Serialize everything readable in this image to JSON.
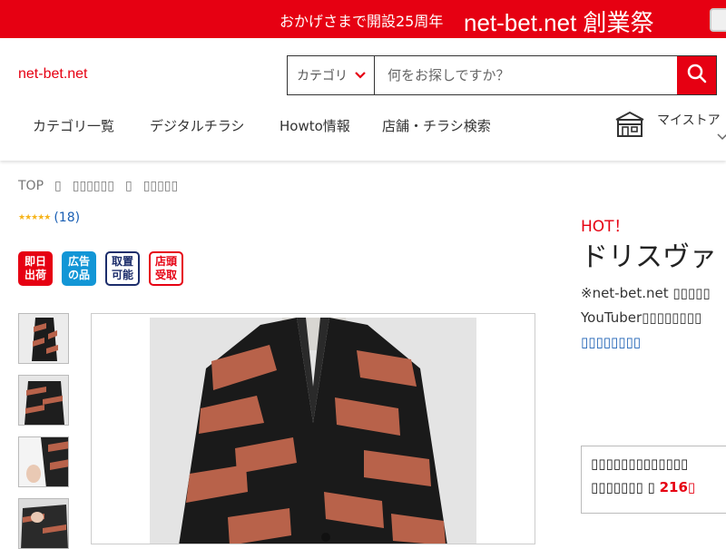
{
  "banner": {
    "subtitle": "おかげさまで開設25周年",
    "title": "net-bet.net 創業祭"
  },
  "header": {
    "logo": "net-bet.net",
    "search": {
      "category_label": "カテゴリ",
      "placeholder": "何をお探しですか？"
    },
    "nav": [
      {
        "label": "カテゴリ一覧"
      },
      {
        "label": "デジタルチラシ"
      },
      {
        "label": "Howto情報"
      },
      {
        "label": "店舗・チラシ検索"
      }
    ],
    "mystore_label": "マイストア"
  },
  "breadcrumb": {
    "top": "TOP",
    "sep": "▯",
    "level1": "▯▯▯▯▯▯",
    "level2": "▯▯▯▯▯"
  },
  "rating": {
    "stars": "★★★★★",
    "count": "(18)"
  },
  "badges": [
    {
      "text": "即日\n出荷",
      "style": "red"
    },
    {
      "text": "広告\nの品",
      "style": "blue"
    },
    {
      "text": "取置\n可能",
      "style": "navy"
    },
    {
      "text": "店頭\n受取",
      "style": "redline"
    }
  ],
  "product": {
    "hot_label": "HOT！",
    "title": "ドリスヴァ",
    "note1": "※net-bet.net ▯▯▯▯▯",
    "note2": "YouTuber▯▯▯▯▯▯▯▯",
    "note3_link": "▯▯▯▯▯▯▯▯",
    "promo_line1": "▯▯▯▯▯▯▯▯▯▯▯▯▯",
    "promo_line2_prefix": "▯▯▯▯▯▯▯ ▯",
    "promo_line2_value": "216▯"
  },
  "colors": {
    "brand_red": "#e60012",
    "link_blue": "#1a5fb4",
    "star": "#f6b41b"
  }
}
